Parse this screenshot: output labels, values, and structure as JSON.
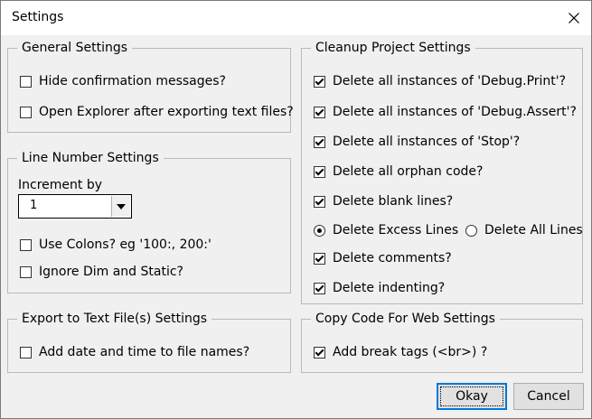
{
  "window": {
    "title": "Settings"
  },
  "general": {
    "legend": "General Settings",
    "items": [
      {
        "label": "Hide confirmation messages?",
        "checked": false
      },
      {
        "label": "Open Explorer after exporting text files?",
        "checked": false
      }
    ]
  },
  "line_number": {
    "legend": "Line Number Settings",
    "increment_label": "Increment by",
    "increment_value": "1",
    "items": [
      {
        "label": "Use Colons? eg '100:, 200:'",
        "checked": false
      },
      {
        "label": "Ignore Dim and Static?",
        "checked": false
      }
    ]
  },
  "export": {
    "legend": "Export to Text File(s) Settings",
    "items": [
      {
        "label": "Add date and time to file names?",
        "checked": false
      }
    ]
  },
  "cleanup": {
    "legend": "Cleanup Project Settings",
    "items": [
      {
        "label": "Delete all instances of 'Debug.Print'?",
        "checked": true
      },
      {
        "label": "Delete all instances of 'Debug.Assert'?",
        "checked": true
      },
      {
        "label": "Delete all instances of 'Stop'?",
        "checked": true
      },
      {
        "label": "Delete all orphan code?",
        "checked": true
      },
      {
        "label": "Delete blank lines?",
        "checked": true
      }
    ],
    "radio_excess": {
      "label": "Delete Excess Lines",
      "selected": true
    },
    "radio_all": {
      "label": "Delete All Lines",
      "selected": false
    },
    "items2": [
      {
        "label": "Delete comments?",
        "checked": true
      },
      {
        "label": "Delete indenting?",
        "checked": true
      }
    ]
  },
  "web": {
    "legend": "Copy Code For Web Settings",
    "items": [
      {
        "label": "Add break tags (<br>) ?",
        "checked": true
      }
    ]
  },
  "buttons": {
    "okay": "Okay",
    "cancel": "Cancel"
  }
}
